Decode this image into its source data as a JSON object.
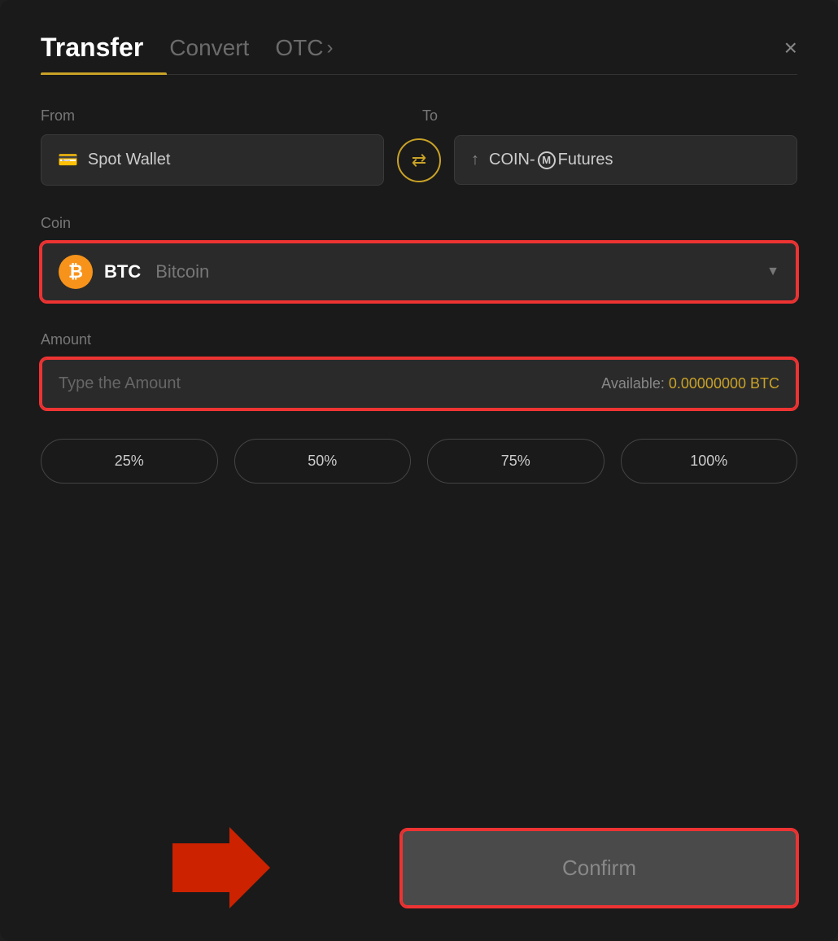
{
  "header": {
    "active_tab": "Transfer",
    "tabs": [
      {
        "id": "transfer",
        "label": "Transfer"
      },
      {
        "id": "convert",
        "label": "Convert"
      },
      {
        "id": "otc",
        "label": "OTC"
      }
    ],
    "close_label": "×"
  },
  "from": {
    "label": "From",
    "wallet_icon": "💳",
    "wallet_text": "Spot Wallet"
  },
  "swap": {
    "icon": "⇄"
  },
  "to": {
    "label": "To",
    "futures_text_pre": "COIN-",
    "futures_m": "M",
    "futures_text_post": " Futures"
  },
  "coin": {
    "label": "Coin",
    "symbol": "BTC",
    "name": "Bitcoin"
  },
  "amount": {
    "label": "Amount",
    "placeholder": "Type the Amount",
    "available_label": "Available:",
    "available_value": "0.00000000 BTC"
  },
  "percentage_buttons": [
    {
      "label": "25%"
    },
    {
      "label": "50%"
    },
    {
      "label": "75%"
    },
    {
      "label": "100%"
    }
  ],
  "confirm": {
    "label": "Confirm"
  }
}
